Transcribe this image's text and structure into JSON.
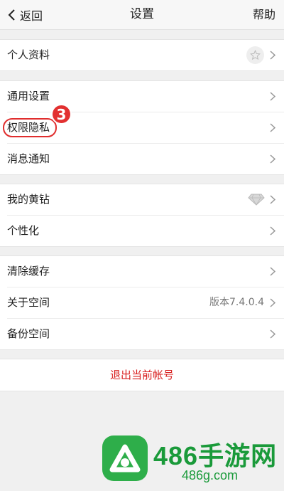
{
  "navbar": {
    "back_label": "返回",
    "title": "设置",
    "help_label": "帮助"
  },
  "groups": [
    {
      "rows": [
        {
          "label": "个人资料"
        }
      ]
    },
    {
      "rows": [
        {
          "label": "通用设置"
        },
        {
          "label": "权限隐私",
          "step": "3"
        },
        {
          "label": "消息通知"
        }
      ]
    },
    {
      "rows": [
        {
          "label": "我的黄钻"
        },
        {
          "label": "个性化"
        }
      ]
    },
    {
      "rows": [
        {
          "label": "清除缓存"
        },
        {
          "label": "关于空间",
          "value": "版本7.4.0.4"
        },
        {
          "label": "备份空间"
        }
      ]
    }
  ],
  "logout_label": "退出当前帐号",
  "watermark": {
    "title": "486手游网",
    "url": "486g.com"
  },
  "colors": {
    "accent_red": "#e02d2d",
    "logout_red": "#d81e1e",
    "watermark_green": "#1a9a3a"
  },
  "icons": [
    "chevron-left-icon",
    "star-icon",
    "diamond-icon",
    "chevron-right-icon"
  ]
}
